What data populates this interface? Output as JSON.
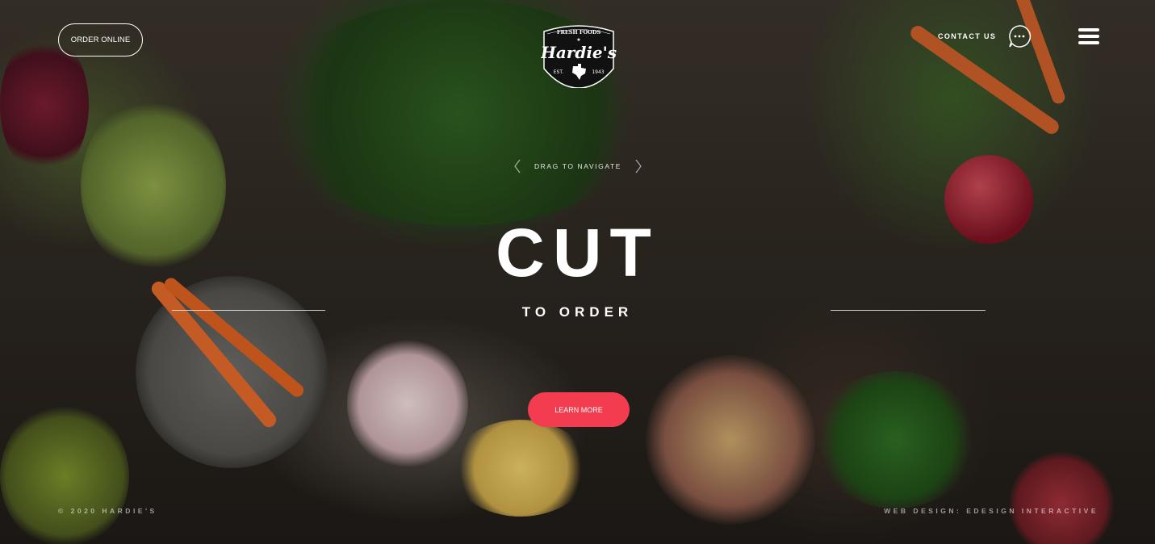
{
  "header": {
    "order_online_label": "ORDER ONLINE",
    "logo": {
      "top_text": "FRESH FOODS",
      "name": "Hardie's",
      "est_label": "EST.",
      "est_year": "1943"
    },
    "contact_label": "CONTACT US"
  },
  "hero": {
    "drag_hint": "DRAG TO NAVIGATE",
    "title": "CUT",
    "subtitle": "TO ORDER",
    "cta_label": "LEARN MORE"
  },
  "footer": {
    "copyright": "© 2020 HARDIE'S",
    "credit": "WEB DESIGN: EDESIGN INTERACTIVE"
  },
  "colors": {
    "accent": "#f33c4f",
    "text": "#ffffff"
  },
  "icons": [
    "chat-bubble-icon",
    "hamburger-menu-icon",
    "chevron-left-icon",
    "chevron-right-icon",
    "texas-state-icon"
  ]
}
